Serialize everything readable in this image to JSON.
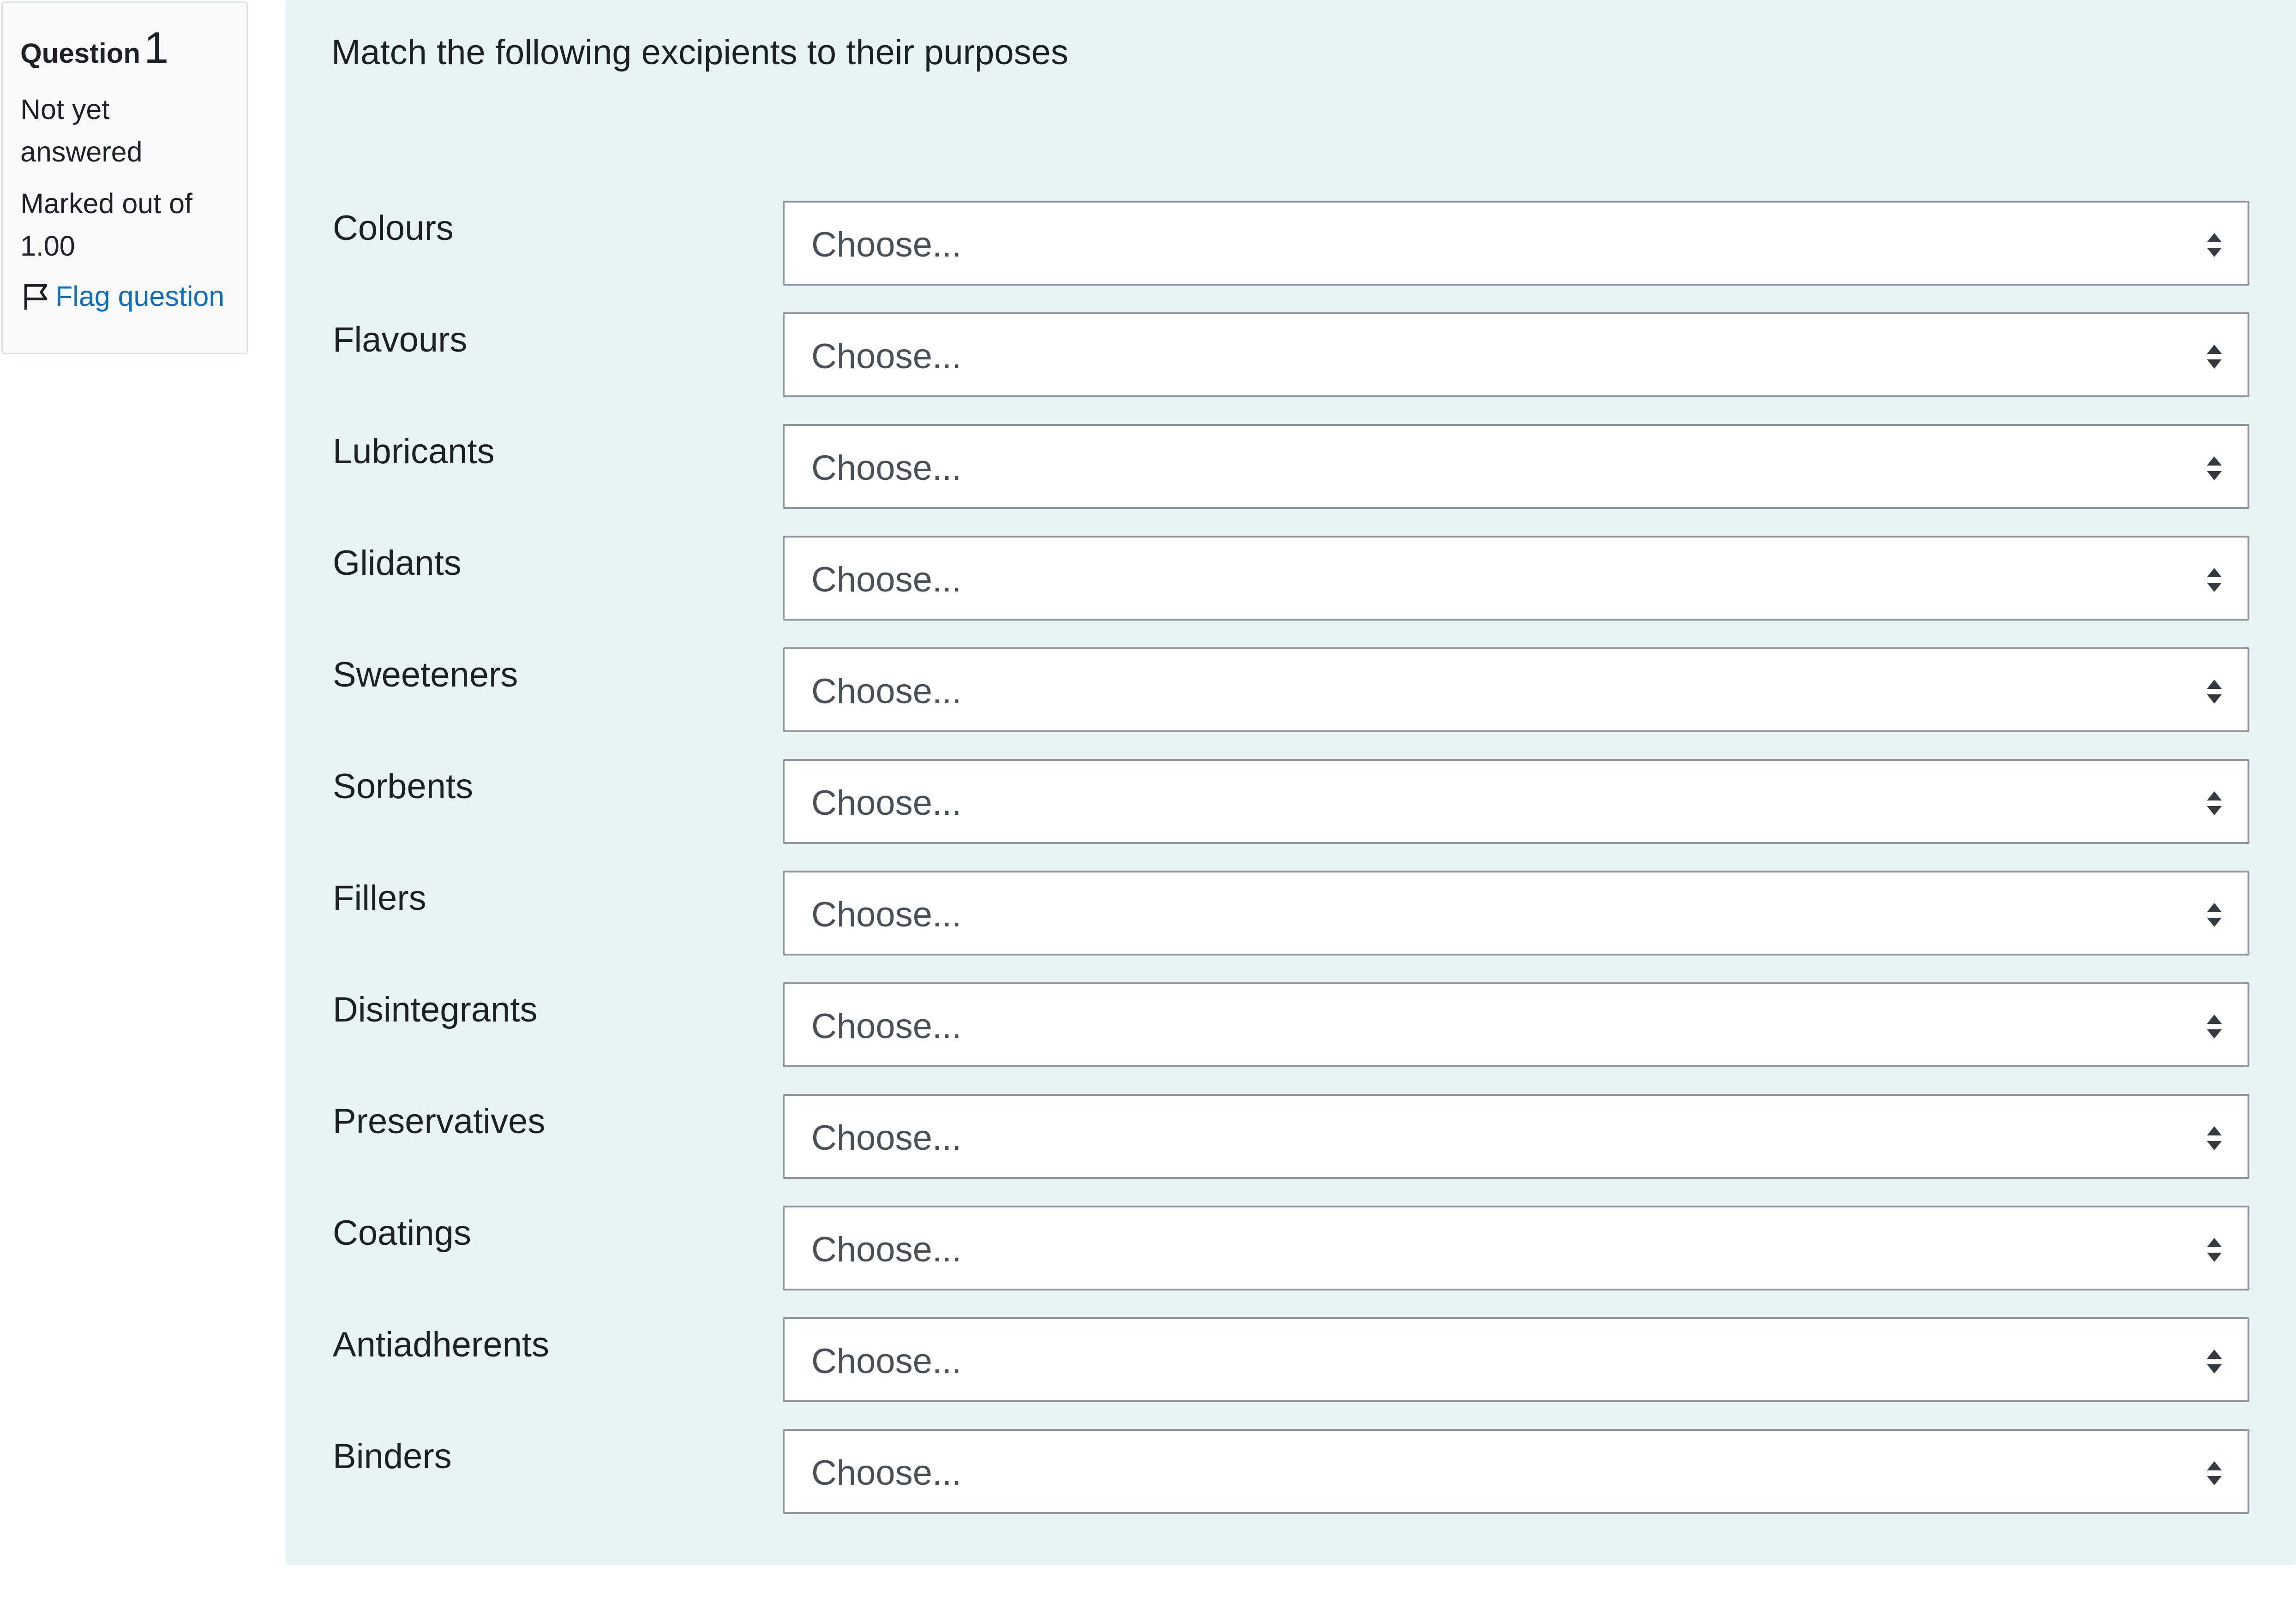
{
  "info": {
    "question_label": "Question",
    "question_number": "1",
    "state": "Not yet answered",
    "grade": "Marked out of 1.00",
    "flag_label": "Flag question"
  },
  "question_text": "Match the following excipients to their purposes",
  "rows": [
    {
      "label": "Colours",
      "value": "Choose..."
    },
    {
      "label": "Flavours",
      "value": "Choose..."
    },
    {
      "label": "Lubricants",
      "value": "Choose..."
    },
    {
      "label": "Glidants",
      "value": "Choose..."
    },
    {
      "label": "Sweeteners",
      "value": "Choose..."
    },
    {
      "label": "Sorbents",
      "value": "Choose..."
    },
    {
      "label": "Fillers",
      "value": "Choose..."
    },
    {
      "label": "Disintegrants",
      "value": "Choose..."
    },
    {
      "label": "Preservatives",
      "value": "Choose..."
    },
    {
      "label": "Coatings",
      "value": "Choose..."
    },
    {
      "label": "Antiadherents",
      "value": "Choose..."
    },
    {
      "label": "Binders",
      "value": "Choose..."
    }
  ],
  "icons": {
    "flag": "flag-icon",
    "select_arrows": "sort-arrows-icon"
  },
  "colors": {
    "link": "#0f6cbf",
    "formulation_bg": "#e7f3f5",
    "info_bg": "#f8f9fa"
  }
}
